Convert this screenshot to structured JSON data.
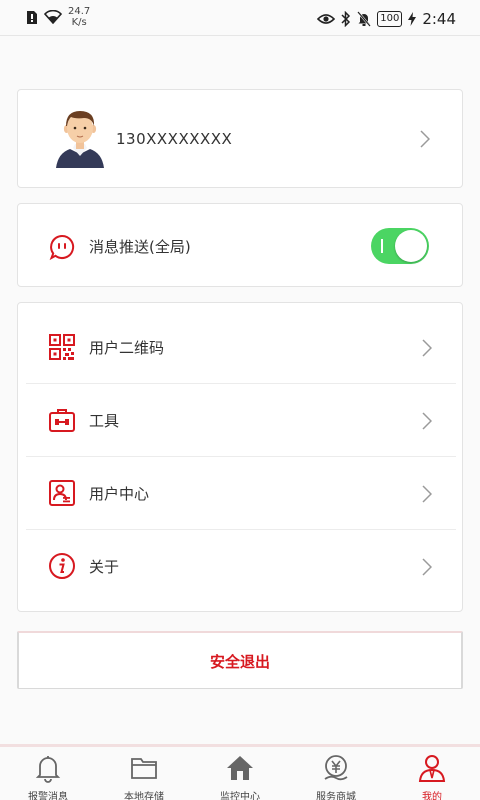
{
  "status_bar": {
    "speed_value": "24.7",
    "speed_unit": "K/s",
    "battery": "100",
    "time": "2:44"
  },
  "profile": {
    "phone": "130XXXXXXXX"
  },
  "push": {
    "label": "消息推送(全局)",
    "enabled": true
  },
  "menu": {
    "items": [
      {
        "label": "用户二维码",
        "icon": "qr-code-icon"
      },
      {
        "label": "工具",
        "icon": "toolbox-icon"
      },
      {
        "label": "用户中心",
        "icon": "user-card-icon"
      },
      {
        "label": "关于",
        "icon": "info-icon"
      }
    ]
  },
  "logout": {
    "label": "安全退出"
  },
  "tabs": [
    {
      "label": "报警消息",
      "icon": "bell-icon"
    },
    {
      "label": "本地存储",
      "icon": "folder-icon"
    },
    {
      "label": "监控中心",
      "icon": "home-icon"
    },
    {
      "label": "服务商城",
      "icon": "shop-icon"
    },
    {
      "label": "我的",
      "icon": "user-icon",
      "active": true
    }
  ],
  "colors": {
    "accent": "#d71920",
    "toggle_on": "#4bd563"
  }
}
